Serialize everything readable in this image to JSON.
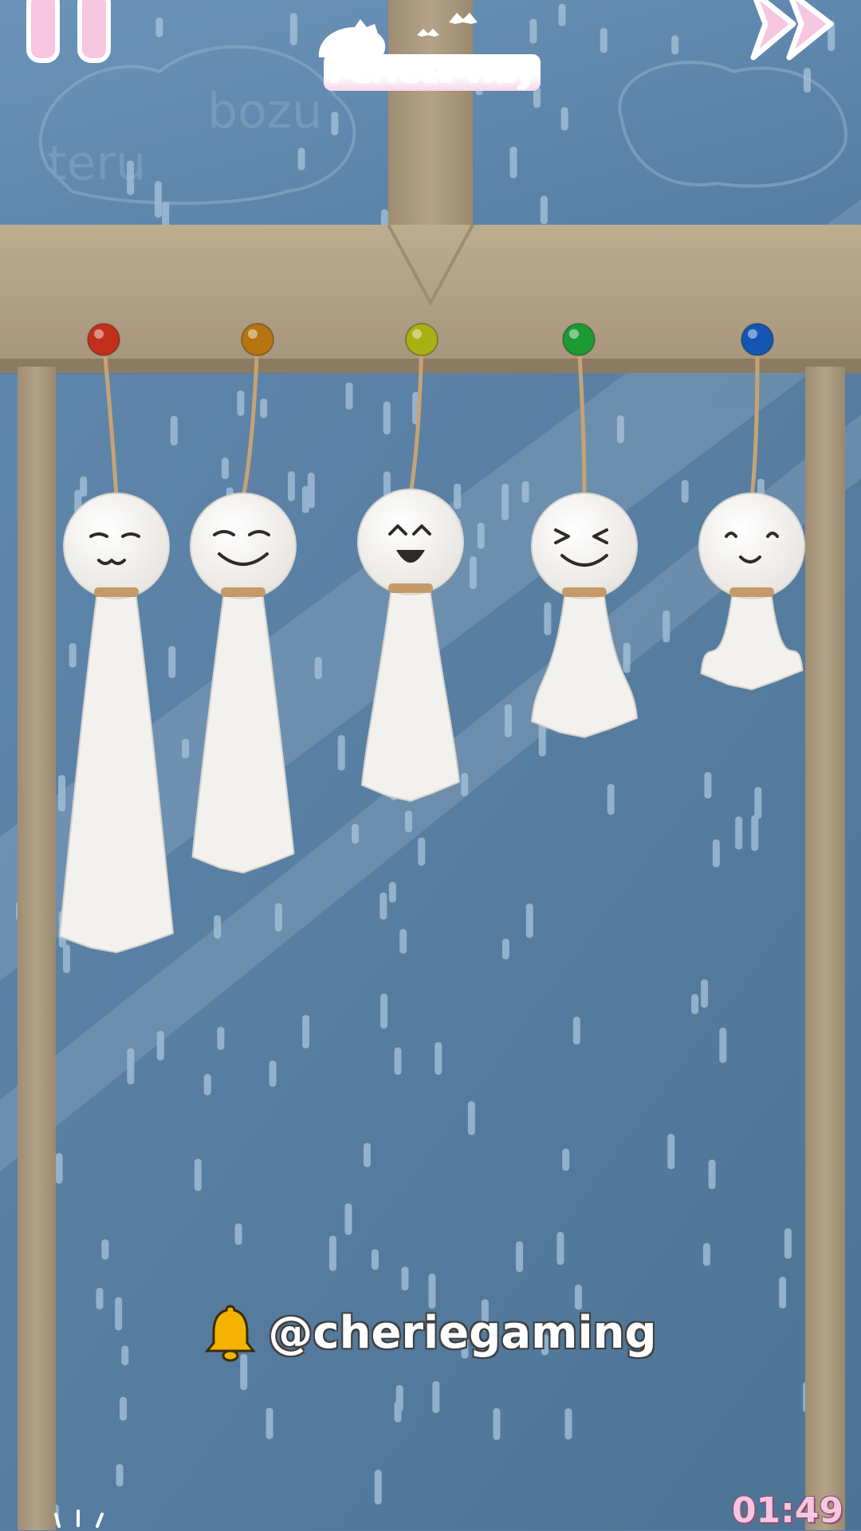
{
  "game": {
    "title": "Perfect Tidy",
    "channel_handle": "@cheriegaming",
    "timer": "01:49"
  },
  "hud": {
    "pause_icon": "pause-icon",
    "skip_icon": "fast-forward-icon",
    "notification_icon": "bell-icon"
  },
  "dolls": [
    {
      "pin_color": "#c2301d",
      "face": "smug"
    },
    {
      "pin_color": "#b87410",
      "face": "content"
    },
    {
      "pin_color": "#a9b012",
      "face": "laughing"
    },
    {
      "pin_color": "#1e9a34",
      "face": "squint"
    },
    {
      "pin_color": "#1356b3",
      "face": "smile"
    }
  ],
  "colors": {
    "sky": "#5a7fa0",
    "frame": "#b3a287",
    "frame_dark": "#8f7f65",
    "accent_pink": "#f7c6e0",
    "cloth": "#f3f1ee"
  }
}
